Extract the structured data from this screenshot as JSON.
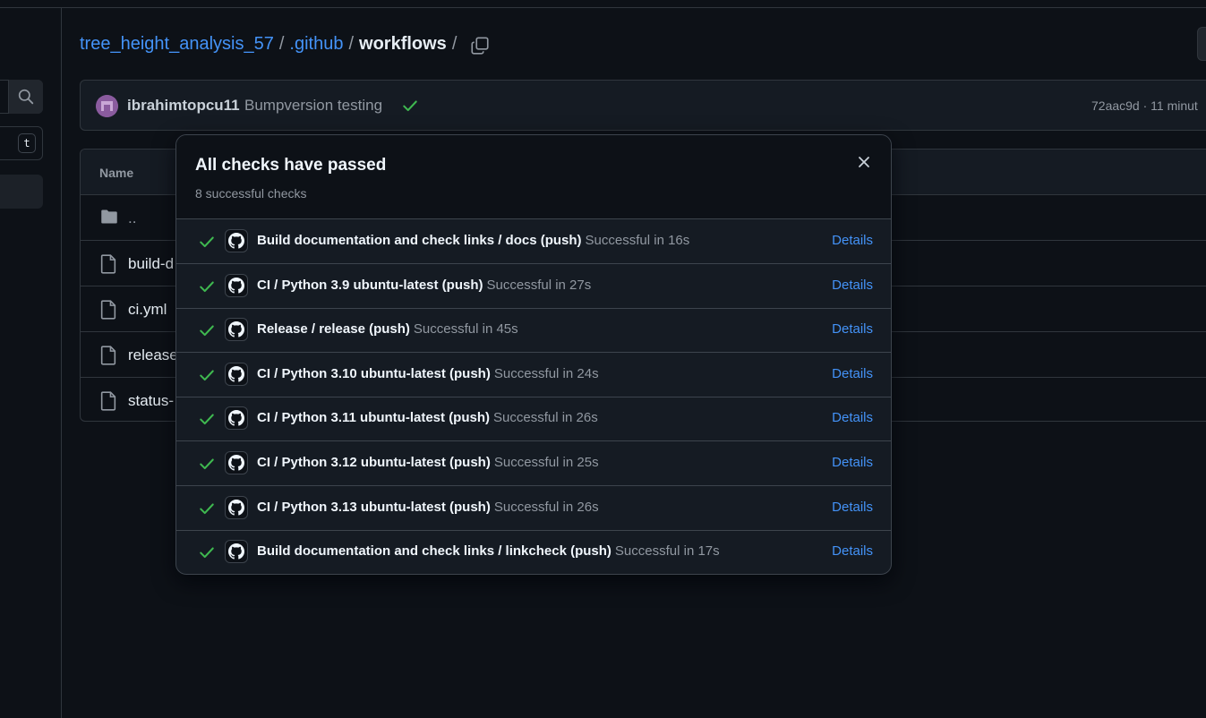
{
  "breadcrumb": {
    "repo": "tree_height_analysis_57",
    "folder": ".github",
    "current": "workflows",
    "separator": "/"
  },
  "sidebar": {
    "goto_shortcut": "t"
  },
  "commit": {
    "author": "ibrahimtopcu11",
    "message": "Bumpversion testing",
    "meta": "72aac9d · 11 minut"
  },
  "file_table": {
    "header_name": "Name",
    "rows": [
      {
        "name": "..",
        "type": "folder"
      },
      {
        "name": "build-d",
        "type": "file"
      },
      {
        "name": "ci.yml",
        "type": "file"
      },
      {
        "name": "release",
        "type": "file"
      },
      {
        "name": "status-",
        "type": "file"
      }
    ]
  },
  "checks_popover": {
    "title": "All checks have passed",
    "subtitle": "8 successful checks",
    "details_label": "Details",
    "checks": [
      {
        "name": "Build documentation and check links / docs (push)",
        "status": "Successful in 16s"
      },
      {
        "name": "CI / Python 3.9 ubuntu-latest (push)",
        "status": "Successful in 27s"
      },
      {
        "name": "Release / release (push)",
        "status": "Successful in 45s"
      },
      {
        "name": "CI / Python 3.10 ubuntu-latest (push)",
        "status": "Successful in 24s"
      },
      {
        "name": "CI / Python 3.11 ubuntu-latest (push)",
        "status": "Successful in 26s"
      },
      {
        "name": "CI / Python 3.12 ubuntu-latest (push)",
        "status": "Successful in 25s"
      },
      {
        "name": "CI / Python 3.13 ubuntu-latest (push)",
        "status": "Successful in 26s"
      },
      {
        "name": "Build documentation and check links / linkcheck (push)",
        "status": "Successful in 17s"
      }
    ]
  },
  "colors": {
    "background": "#0d1117",
    "link": "#4493f8",
    "success": "#3fb950",
    "muted": "#9198a1",
    "border": "#30363d"
  }
}
